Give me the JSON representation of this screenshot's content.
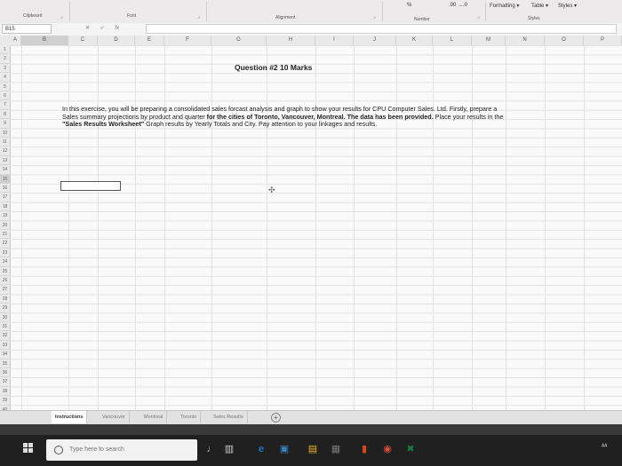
{
  "ribbon": {
    "groups": [
      "Clipboard",
      "Font",
      "Alignment",
      "Number",
      "Styles"
    ],
    "decimal_buttons": ".00 →.0",
    "style_buttons": [
      "Formatting ▾",
      "Table ▾",
      "Styles ▾"
    ],
    "percent": "%"
  },
  "formula_bar": {
    "name_box": "B15",
    "cancel": "✕",
    "confirm": "✓",
    "fx": "fx",
    "content": ""
  },
  "columns": [
    "A",
    "B",
    "C",
    "D",
    "E",
    "F",
    "G",
    "H",
    "I",
    "J",
    "K",
    "L",
    "M",
    "N",
    "O",
    "P"
  ],
  "rows": [
    "1",
    "2",
    "3",
    "4",
    "5",
    "6",
    "7",
    "8",
    "9",
    "10",
    "11",
    "12",
    "13",
    "14",
    "15",
    "16",
    "17",
    "18",
    "19",
    "20",
    "21",
    "22",
    "23",
    "24",
    "25",
    "26",
    "27",
    "28",
    "29",
    "30",
    "31",
    "32",
    "33",
    "34",
    "35",
    "36",
    "37",
    "38",
    "39",
    "40"
  ],
  "sheet": {
    "title": "Question #2  10 Marks",
    "para1": "In this exercise, you will be preparing a consolidated sales forcast analysis and graph to show your results for CPU Computer Sales. Ltd. Firstly, prepare a Sales summary projections by product and quarter ",
    "para_bold1": "for the cities of Toronto, Vancouver, Montreal. The data has been provided.",
    "para2": " Place your results in the ",
    "para_bold2": "\"Sales Results Worksheet\"",
    "para3": " Graph results by Yearly Totals and City. Pay attention to your linkages and results."
  },
  "tabs": [
    "Instructions",
    "Vancouver",
    "Montreal",
    "Toronto",
    "Sales Results"
  ],
  "active_tab": "Instructions",
  "taskbar": {
    "search_placeholder": "Type here to search"
  }
}
